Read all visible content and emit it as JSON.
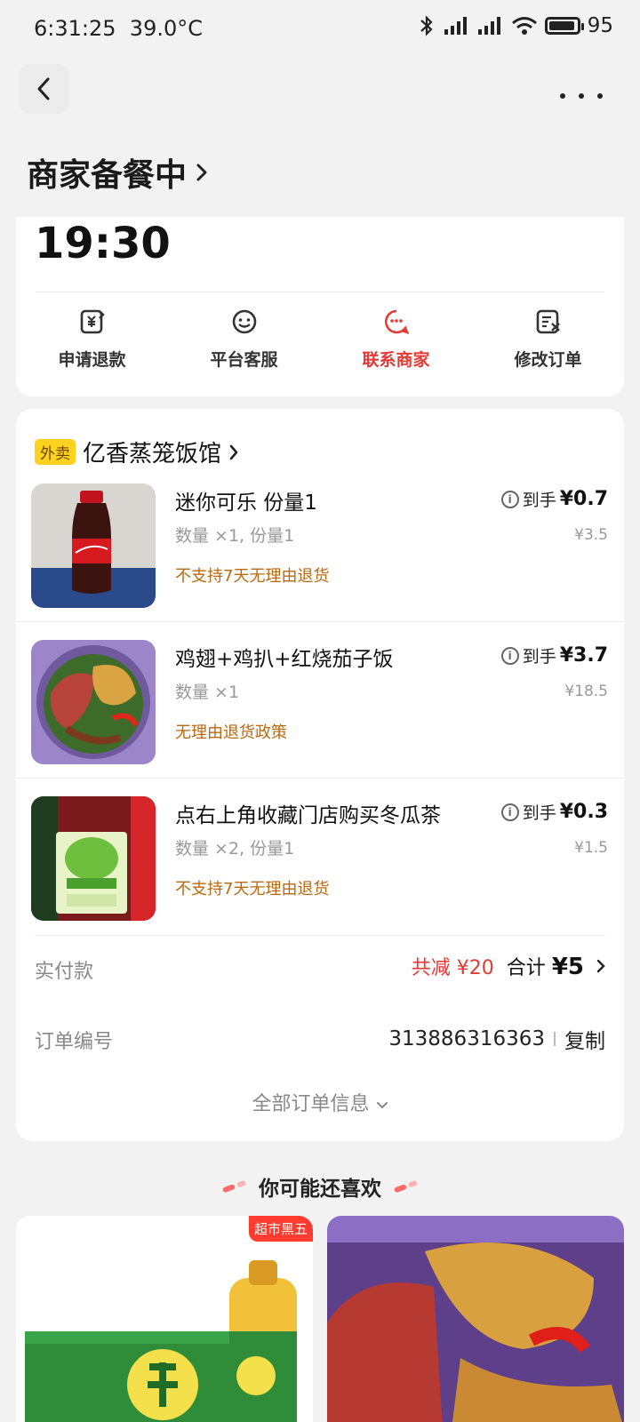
{
  "status_bar": {
    "time": "6:31:25",
    "temp": "39.0°C",
    "battery": "95",
    "battery_level": 0.95
  },
  "header": {
    "status_title": "商家备餐中",
    "eta": "19:30"
  },
  "actions": [
    {
      "label": "申请退款",
      "icon": "refund-icon"
    },
    {
      "label": "平台客服",
      "icon": "service-icon"
    },
    {
      "label": "联系商家",
      "icon": "merchant-chat-icon",
      "accent": "#e53935"
    },
    {
      "label": "修改订单",
      "icon": "edit-order-icon"
    }
  ],
  "shop": {
    "tag": "外卖",
    "name": "亿香蒸笼饭馆"
  },
  "items": [
    {
      "name": "迷你可乐 份量1",
      "qty": "数量 ×1, 份量1",
      "policy": "不支持7天无理由退货",
      "arrive_label": "到手",
      "price": "¥0.7",
      "orig_price": "¥3.5"
    },
    {
      "name": "鸡翅+鸡扒+红烧茄子饭",
      "qty": "数量 ×1",
      "policy": "无理由退货政策",
      "arrive_label": "到手",
      "price": "¥3.7",
      "orig_price": "¥18.5"
    },
    {
      "name": "点右上角收藏门店购买冬瓜茶",
      "qty": "数量 ×2, 份量1",
      "policy": "不支持7天无理由退货",
      "arrive_label": "到手",
      "price": "¥0.3",
      "orig_price": "¥1.5"
    }
  ],
  "payment": {
    "label": "实付款",
    "discount": "共减 ¥20",
    "total_label": "合计",
    "total": "¥5"
  },
  "order": {
    "label": "订单编号",
    "number": "313886316363",
    "copy": "复制"
  },
  "all_info": "全部订单信息",
  "recommend": {
    "title": "你可能还喜欢",
    "badge": "超市黑五"
  },
  "colors": {
    "accent": "#e53935",
    "policy": "#b86a12",
    "tag_bg": "#ffd21f"
  }
}
